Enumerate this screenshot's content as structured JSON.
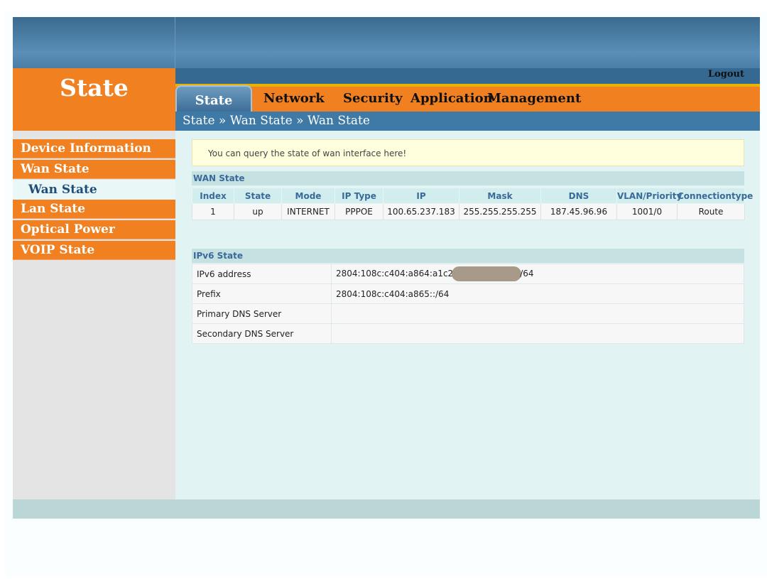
{
  "brand": {
    "title": "State"
  },
  "header": {
    "logout": "Logout"
  },
  "nav": {
    "tabs": [
      {
        "label": "State",
        "active": true
      },
      {
        "label": "Network"
      },
      {
        "label": "Security"
      },
      {
        "label": "Application"
      },
      {
        "label": "Management"
      }
    ]
  },
  "breadcrumb": "State » Wan State » Wan State",
  "sidebar": {
    "items": [
      {
        "label": "Device Information"
      },
      {
        "label": "Wan State"
      },
      {
        "label": "Wan State",
        "sub": true,
        "selected": true
      },
      {
        "label": "Lan State"
      },
      {
        "label": "Optical Power"
      },
      {
        "label": "VOIP State"
      }
    ]
  },
  "notice": "You can query the state of wan interface here!",
  "wan": {
    "title": "WAN State",
    "headers": [
      "Index",
      "State",
      "Mode",
      "IP Type",
      "IP",
      "Mask",
      "DNS",
      "VLAN/Priority",
      "Connectiontype"
    ],
    "rows": [
      [
        "1",
        "up",
        "INTERNET",
        "PPPOE",
        "100.65.237.183",
        "255.255.255.255",
        "187.45.96.96",
        "1001/0",
        "Route"
      ]
    ]
  },
  "ipv6": {
    "title": "IPv6 State",
    "rows": [
      {
        "label": "IPv6 address",
        "value_prefix": "2804:108c:c404:a864:a1c2",
        "value_suffix": "/64",
        "redacted": true
      },
      {
        "label": "Prefix",
        "value": "2804:108c:c404:a865::/64"
      },
      {
        "label": "Primary DNS Server",
        "value": ""
      },
      {
        "label": "Secondary DNS Server",
        "value": ""
      }
    ]
  },
  "colors": {
    "accent": "#f08020",
    "header_blue": "#3f7aa6",
    "panel": "#e1f3f3"
  }
}
